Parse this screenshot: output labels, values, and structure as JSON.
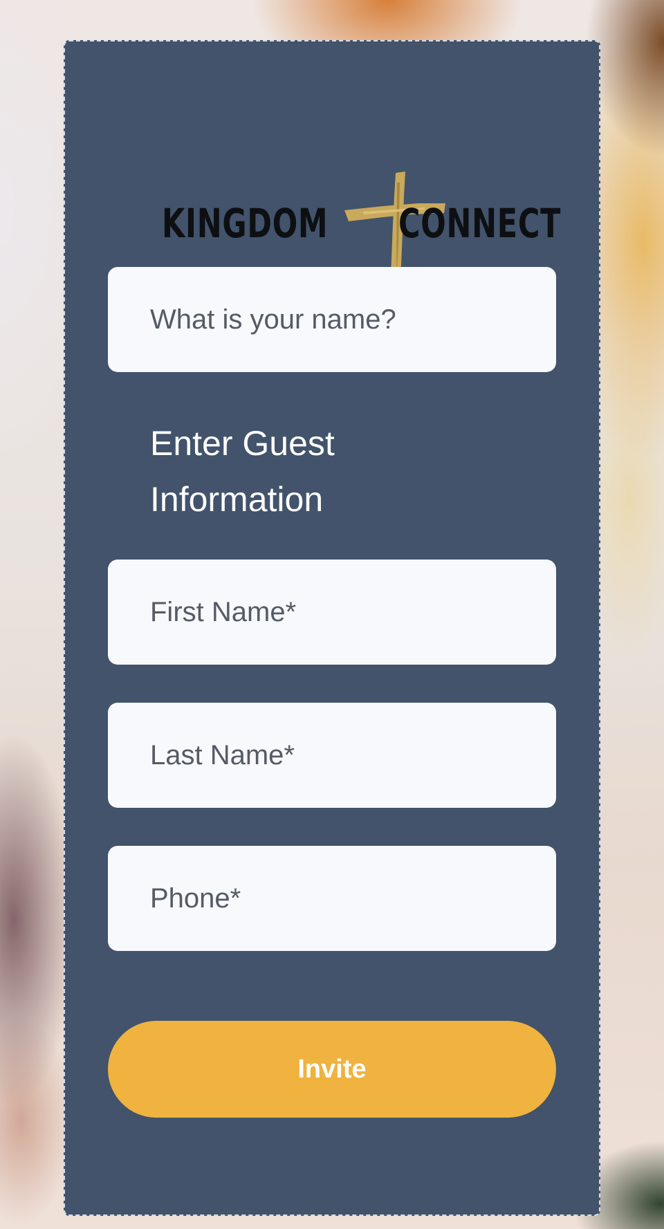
{
  "logo": {
    "text_left": "KINGDOM",
    "text_right": "CONNECT",
    "cross_color": "#c9a95a"
  },
  "form": {
    "name_placeholder": "What is your name?",
    "section_title": "Enter Guest Information",
    "first_name_placeholder": "First Name*",
    "last_name_placeholder": "Last Name*",
    "phone_placeholder": "Phone*",
    "submit_label": "Invite"
  },
  "colors": {
    "card_background": "#42536b",
    "field_background": "#f7f9fc",
    "button_background": "#f0b33f",
    "button_text": "#ffffff"
  }
}
